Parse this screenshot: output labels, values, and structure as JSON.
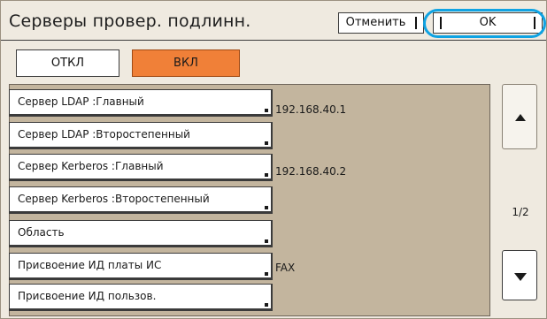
{
  "window": {
    "title": "Серверы провер. подлинн."
  },
  "actions": {
    "cancel_label": "Отменить",
    "ok_label": "OK"
  },
  "toggle": {
    "off_label": "ОТКЛ",
    "on_label": "ВКЛ",
    "selected": "ВКЛ"
  },
  "items": [
    {
      "label": "Сервер LDAP :Главный",
      "value": "192.168.40.1"
    },
    {
      "label": "Сервер LDAP :Второстепенный",
      "value": ""
    },
    {
      "label": "Сервер Kerberos :Главный",
      "value": "192.168.40.2"
    },
    {
      "label": "Сервер Kerberos :Второстепенный",
      "value": ""
    },
    {
      "label": "Область",
      "value": ""
    },
    {
      "label": "Присвоение ИД платы ИС",
      "value": "FAX"
    },
    {
      "label": "Присвоение ИД пользов.",
      "value": ""
    }
  ],
  "pager": {
    "indicator": "1/2"
  },
  "colors": {
    "panel_bg": "#efeae0",
    "list_bg": "#c3b59e",
    "toggle_on": "#f08038",
    "highlight_ring": "#0fa3e3"
  },
  "icons": {
    "scroll_up": "triangle-up",
    "scroll_down": "triangle-down"
  }
}
